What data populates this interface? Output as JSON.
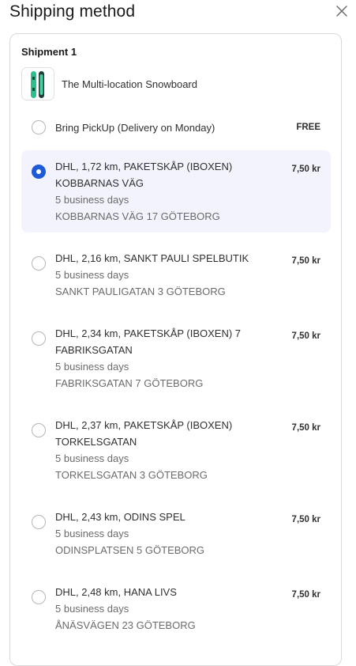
{
  "header": {
    "title": "Shipping method"
  },
  "shipment": {
    "label": "Shipment 1",
    "product_name": "The Multi-location Snowboard",
    "product_icon": "snowboard-thumbnail"
  },
  "options": [
    {
      "title": "Bring PickUp (Delivery on Monday)",
      "price": "FREE",
      "selected": false
    },
    {
      "title": "DHL, 1,72 km, PAKETSKÅP (IBOXEN) KOBBARNAS VÄG",
      "days": "5 business days",
      "address": "KOBBARNAS VÄG 17 GÖTEBORG",
      "price": "7,50 kr",
      "selected": true
    },
    {
      "title": "DHL, 2,16 km, SANKT PAULI SPELBUTIK",
      "days": "5 business days",
      "address": "SANKT PAULIGATAN 3 GÖTEBORG",
      "price": "7,50 kr",
      "selected": false
    },
    {
      "title": "DHL, 2,34 km, PAKETSKÅP (IBOXEN) 7 FABRIKSGATAN",
      "days": "5 business days",
      "address": "FABRIKSGATAN 7 GÖTEBORG",
      "price": "7,50 kr",
      "selected": false
    },
    {
      "title": "DHL, 2,37 km, PAKETSKÅP (IBOXEN) TORKELSGATAN",
      "days": "5 business days",
      "address": "TORKELSGATAN 3 GÖTEBORG",
      "price": "7,50 kr",
      "selected": false
    },
    {
      "title": "DHL, 2,43 km, ODINS SPEL",
      "days": "5 business days",
      "address": "ODINSPLATSEN 5 GÖTEBORG",
      "price": "7,50 kr",
      "selected": false
    },
    {
      "title": "DHL, 2,48 km, HANA LIVS",
      "days": "5 business days",
      "address": "ÅNÄSVÄGEN 23 GÖTEBORG",
      "price": "7,50 kr",
      "selected": false
    }
  ],
  "colors": {
    "accent": "#1f5bd7",
    "selected_bg": "#f3f3fd",
    "text": "#303030",
    "muted": "#6b6b6b",
    "border": "#d9d9d9"
  }
}
